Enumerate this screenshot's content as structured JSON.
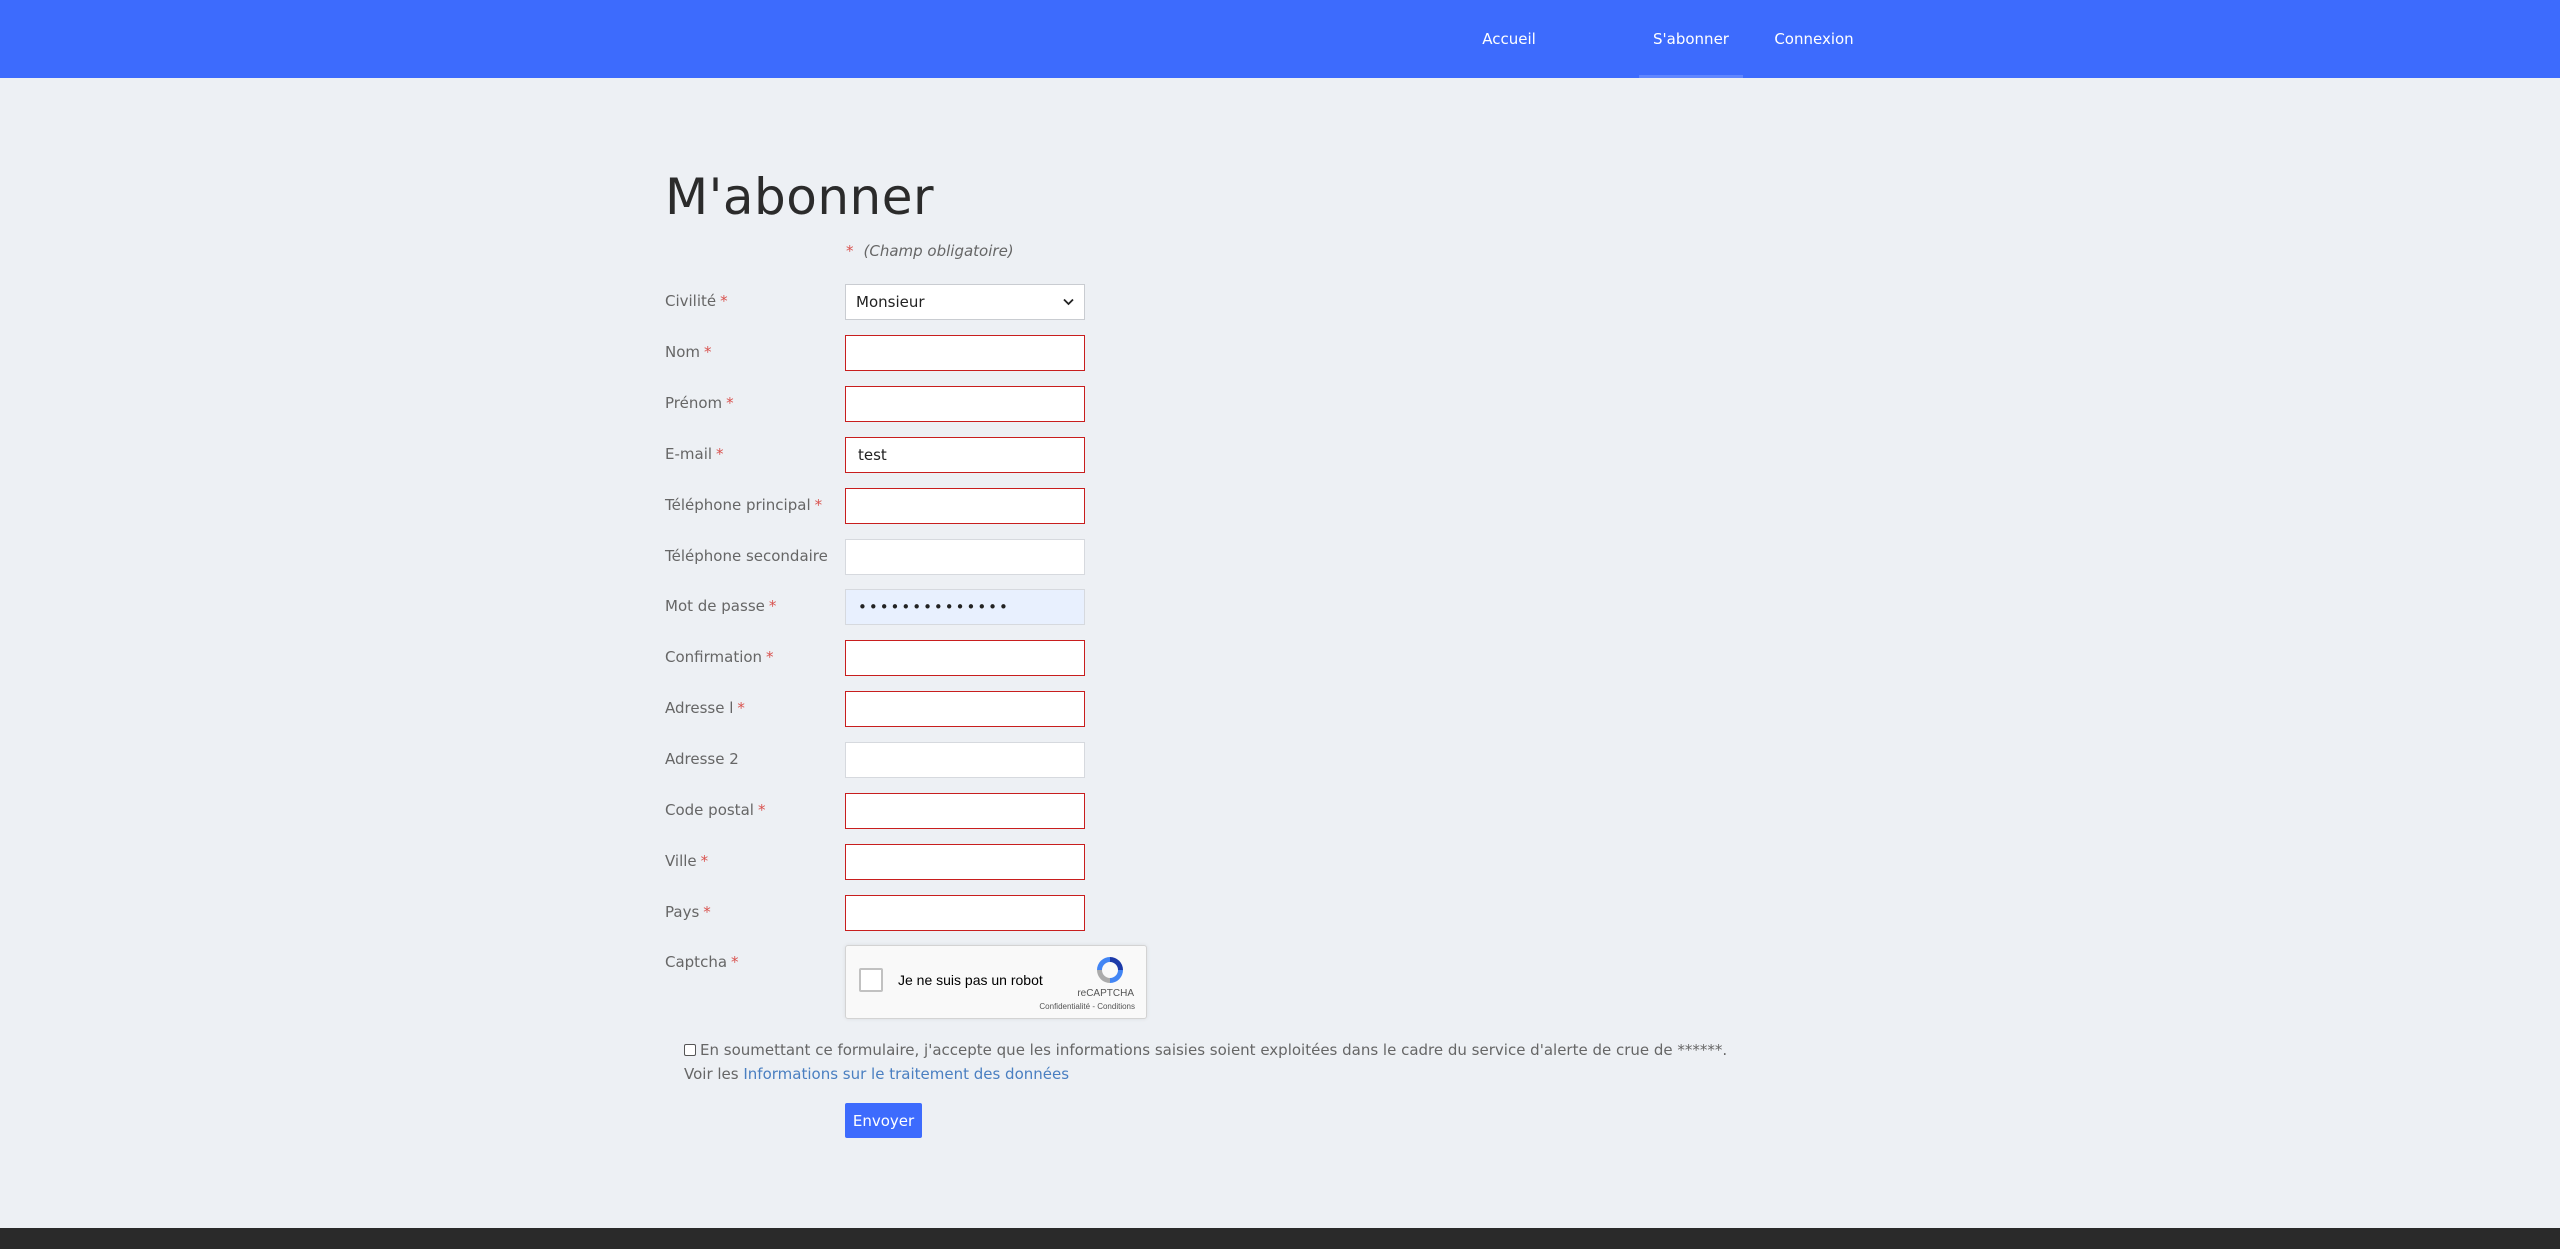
{
  "nav": {
    "accueil": "Accueil",
    "abonner": "S'abonner",
    "connexion": "Connexion"
  },
  "page": {
    "title": "M'abonner",
    "required_star": "*",
    "required_note": "(Champ obligatoire)"
  },
  "form": {
    "civilite": {
      "label": "Civilité",
      "value": "Monsieur"
    },
    "nom": {
      "label": "Nom",
      "value": ""
    },
    "prenom": {
      "label": "Prénom",
      "value": ""
    },
    "email": {
      "label": "E-mail",
      "value": "test"
    },
    "tel1": {
      "label": "Téléphone principal",
      "value": ""
    },
    "tel2": {
      "label": "Téléphone secondaire",
      "value": ""
    },
    "password": {
      "label": "Mot de passe",
      "value": "••••••••••••••"
    },
    "confirmation": {
      "label": "Confirmation",
      "value": ""
    },
    "adresse1": {
      "label": "Adresse l",
      "value": ""
    },
    "adresse2": {
      "label": "Adresse 2",
      "value": ""
    },
    "cp": {
      "label": "Code postal",
      "value": ""
    },
    "ville": {
      "label": "Ville",
      "value": ""
    },
    "pays": {
      "label": "Pays",
      "value": ""
    },
    "captcha": {
      "label": "Captcha"
    }
  },
  "recaptcha": {
    "text": "Je ne suis pas un robot",
    "brand": "reCAPTCHA",
    "terms": "Confidentialité - Conditions"
  },
  "consent": {
    "text": "En soumettant ce formulaire, j'accepte que les informations saisies soient exploitées dans le cadre du service d'alerte de crue de ******.",
    "see": "Voir les",
    "link": "Informations sur le traitement des données"
  },
  "submit_label": "Envoyer",
  "colors": {
    "brand": "#3d6bfd",
    "required": "#d9534f",
    "error_border": "#c81e1e"
  }
}
